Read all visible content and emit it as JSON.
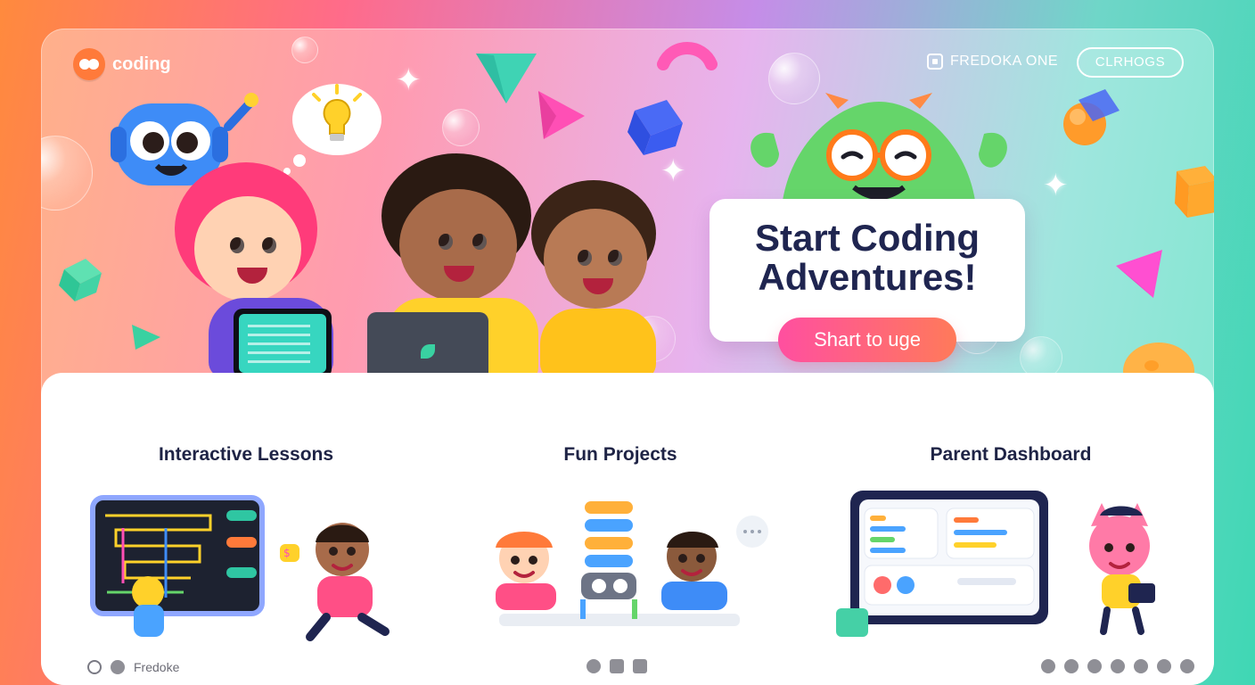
{
  "brand": {
    "name": "coding",
    "logo_icon": "coding-logo-icon",
    "colors": {
      "accent": "#ff7a3a",
      "cta_start": "#ff4fa0",
      "cta_end": "#ff7a5a",
      "title": "#1f2550"
    }
  },
  "nav": {
    "link_label": "FREDOKA ONE",
    "link_icon": "puzzle-icon",
    "button_label": "CLRHOGS"
  },
  "hero": {
    "title_line1": "Start Coding",
    "title_line2": "Adventures!",
    "cta_label": "Shart to uge"
  },
  "features": [
    {
      "title": "Interactive Lessons",
      "icon": "maze-board-icon"
    },
    {
      "title": "Fun Projects",
      "icon": "robot-building-icon"
    },
    {
      "title": "Parent Dashboard",
      "icon": "dashboard-icon"
    }
  ],
  "footer": {
    "left_label": "Fredoke",
    "left_icons": [
      "circle-icon",
      "twitter-icon"
    ],
    "mid_icons": [
      "twitter-icon",
      "square-icon",
      "grid-icon"
    ],
    "right_icons": [
      "triangle-icon",
      "triangle-icon",
      "triangle-icon",
      "triangle-icon",
      "wheel-icon",
      "chat-icon",
      "facebook-icon"
    ]
  }
}
